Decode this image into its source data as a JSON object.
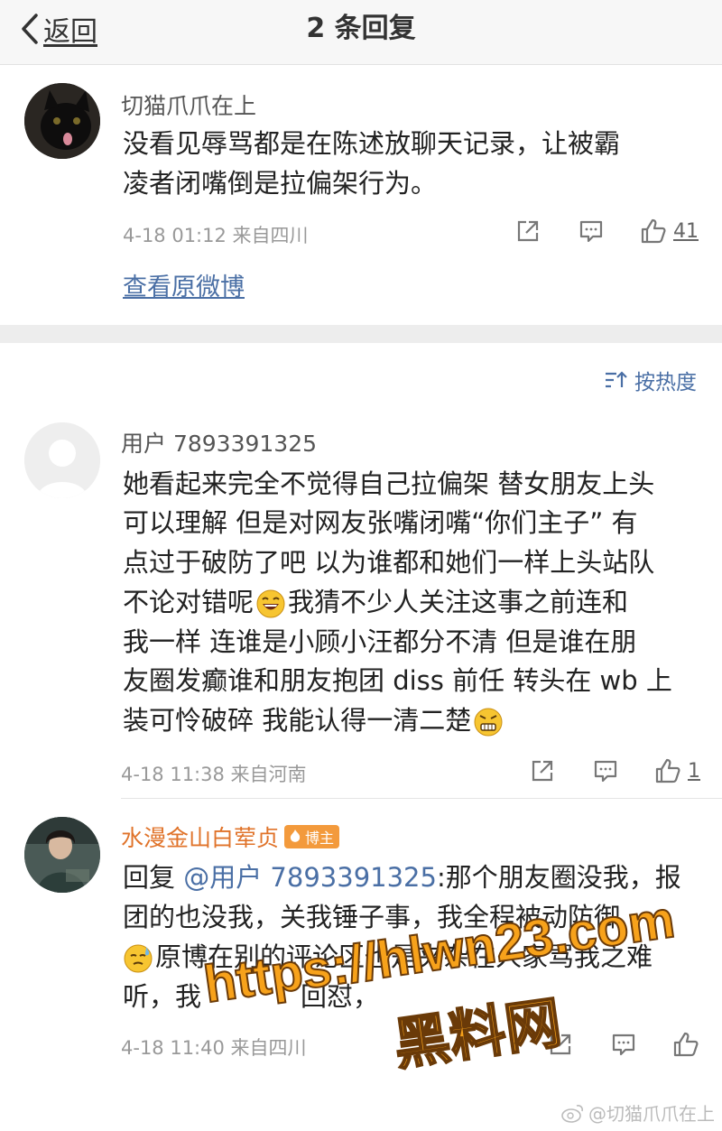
{
  "nav": {
    "back_label": "返回",
    "title": "2 条回复"
  },
  "original": {
    "user": "切猫爪爪在上",
    "text_line1": "没看见辱骂都是在陈述放聊天记录，让被霸",
    "text_line2": "凌者闭嘴倒是拉偏架行为。",
    "meta": "4-18 01:12  来自四川",
    "likes": "41",
    "view_original": "查看原微博"
  },
  "sort_label": "按热度",
  "replies": [
    {
      "user": "用户 7893391325",
      "lines": [
        "她看起来完全不觉得自己拉偏架 替女朋友上头",
        "可以理解 但是对网友张嘴闭嘴“你们主子” 有",
        "点过于破防了吧 以为谁都和她们一样上头站队",
        "不论对错呢",
        "我猜不少人关注这事之前连和",
        "我一样 连谁是小顾小汪都分不清 但是谁在朋",
        "友圈发癫谁和朋友抱团 diss 前任 转头在 wb 上",
        "装可怜破碎 我能认得一清二楚"
      ],
      "meta": "4-18 11:38  来自河南",
      "likes": "1"
    },
    {
      "user": "水漫金山白荤贞",
      "badge": "博主",
      "reply_prefix": "回复 ",
      "mention": "@用户 7893391325",
      "lines": [
        ":那个朋友圈没我，报",
        "团的也没我，关我锤子事，我全程被动防御",
        "原博在别的评论区也是夹杂在人家骂我之难",
        "听，我",
        "回怼，"
      ],
      "meta": "4-18 11:40  来自四川"
    }
  ],
  "watermark": {
    "url": "https://hlwn23.com",
    "name": "黑料网"
  },
  "credit": "@切猫爪爪在上"
}
